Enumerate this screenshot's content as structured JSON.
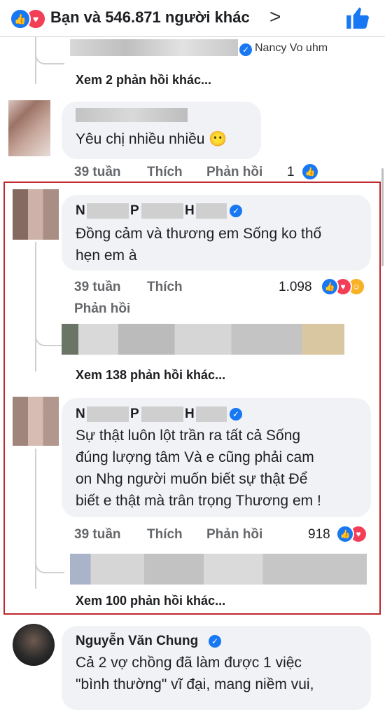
{
  "header": {
    "reactions_text": "Bạn và 546.871 người khác",
    "like_icon": "thumbs-up-icon",
    "love_icon": "heart-icon",
    "chevron_icon": "chevron-right-icon"
  },
  "top_reply": {
    "name_fragment": "Nancy Vo uhm",
    "more_replies": "Xem 2 phản hồi khác..."
  },
  "comment1": {
    "text": "Yêu chị nhiều nhiều 😶",
    "time": "39 tuần",
    "like": "Thích",
    "reply": "Phản hồi",
    "reaction_count": "1"
  },
  "comment2": {
    "name_parts": [
      "N",
      "P",
      "H"
    ],
    "text_line1": "Đồng cảm và thương em Sống ko thố",
    "text_line2": "hẹn em à",
    "time": "39 tuần",
    "like": "Thích",
    "reply": "Phản hồi",
    "reaction_count": "1.098",
    "more_replies": "Xem 138 phản hồi khác..."
  },
  "comment3": {
    "name_parts": [
      "N",
      "P",
      "H"
    ],
    "text_line1": "Sự thật luôn lột trần ra tất cả Sống",
    "text_line2": "đúng lượng tâm Và e cũng phải cam",
    "text_line3": "on Nhg người muốn biết sự thật Để",
    "text_line4": "biết e thật mà trân trọng Thương em !",
    "time": "39 tuần",
    "like": "Thích",
    "reply": "Phản hồi",
    "reaction_count": "918",
    "more_replies": "Xem 100 phản hồi khác..."
  },
  "comment4": {
    "name": "Nguyễn Văn Chung",
    "text_line1": "Cả 2 vợ chồng đã làm được 1 việc",
    "text_line2": "\"bình thường\" vĩ đại, mang niềm vui,"
  },
  "colors": {
    "accent": "#1877f2",
    "love": "#f33e58",
    "highlight_border": "#c0272d",
    "bubble": "#f0f2f5",
    "meta_text": "#65676b"
  }
}
